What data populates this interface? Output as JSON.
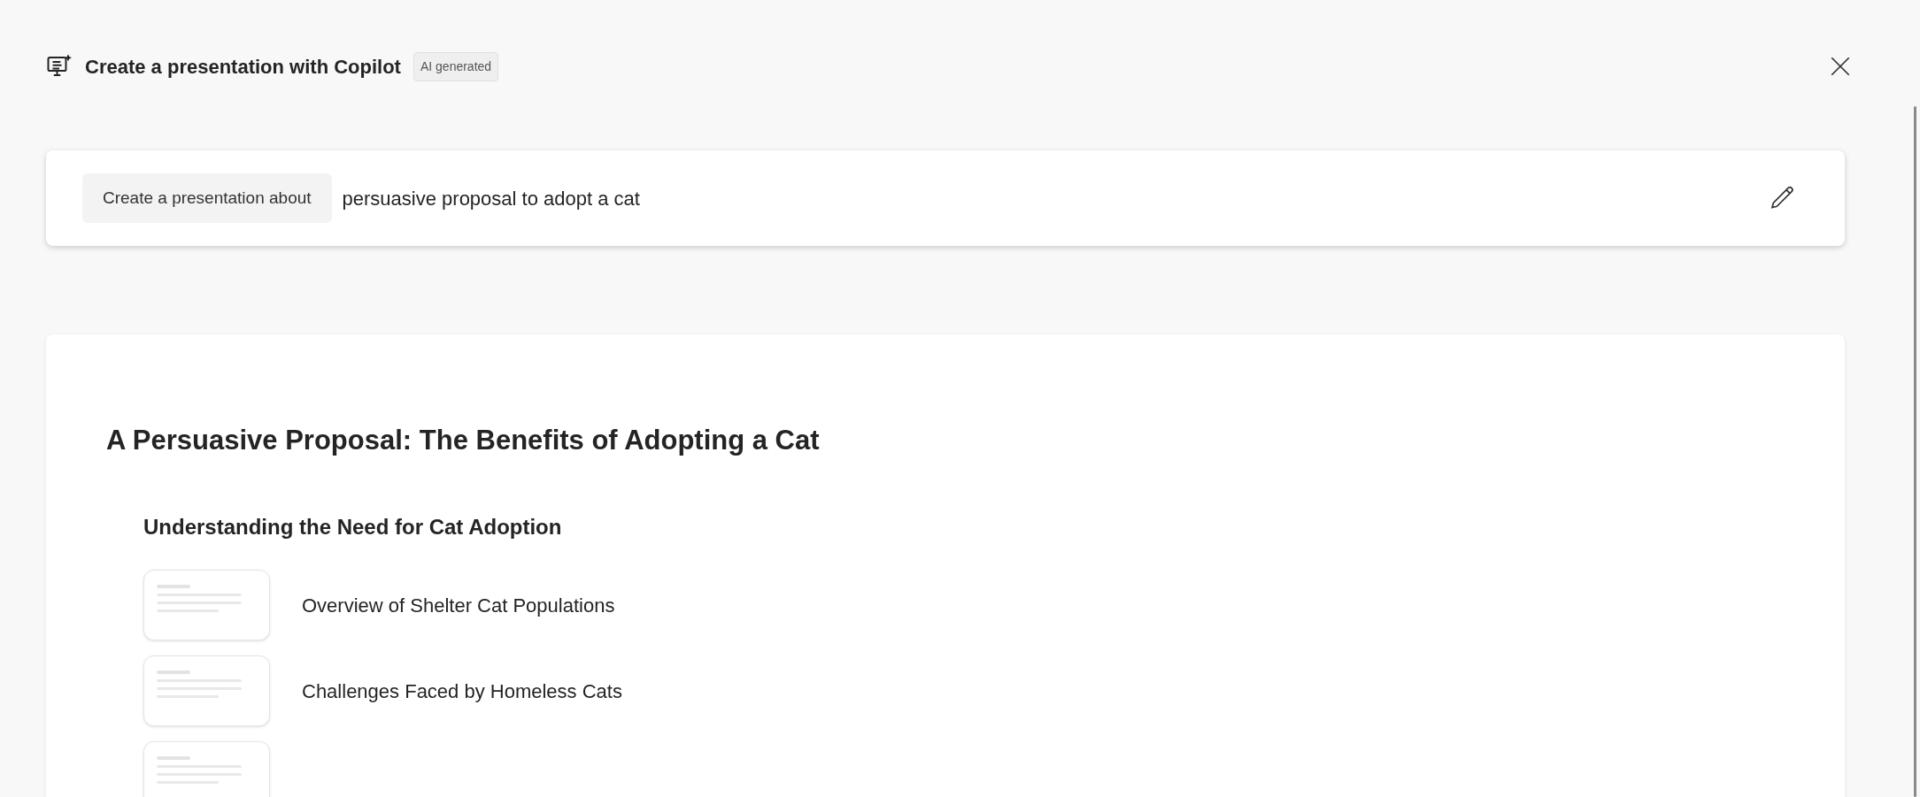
{
  "header": {
    "title": "Create a presentation with Copilot",
    "badge": "AI generated"
  },
  "prompt": {
    "prefix": "Create a presentation about",
    "value": "persuasive proposal to adopt a cat"
  },
  "outline": {
    "title": "A Persuasive Proposal: The Benefits of Adopting a Cat",
    "sections": [
      {
        "heading": "Understanding the Need for Cat Adoption",
        "slides": [
          {
            "kind": "slide",
            "title": "Overview of Shelter Cat Populations"
          },
          {
            "kind": "slide",
            "title": "Challenges Faced by Homeless Cats"
          },
          {
            "kind": "slide"
          }
        ]
      }
    ]
  }
}
